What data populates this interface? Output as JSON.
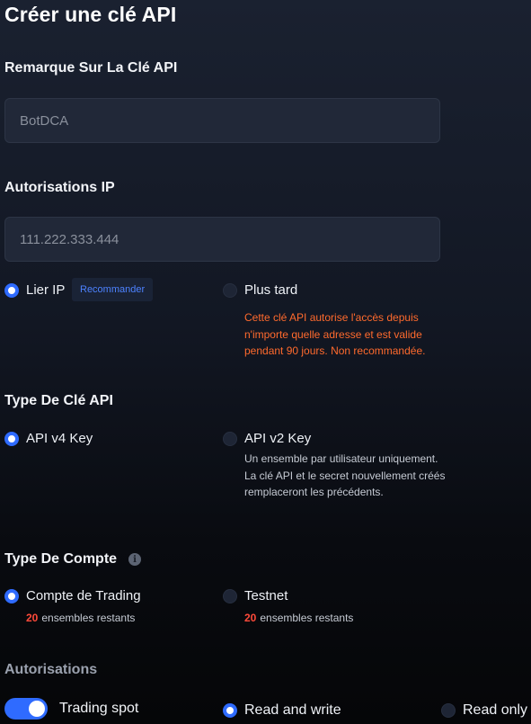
{
  "page": {
    "title": "Créer une clé API"
  },
  "api_note": {
    "label": "Remarque Sur La Clé API",
    "value": "BotDCA"
  },
  "ip_permissions": {
    "label": "Autorisations IP",
    "value": "111.222.333.444",
    "options": [
      {
        "label": "Lier IP",
        "selected": true,
        "badge": "Recommander"
      },
      {
        "label": "Plus tard",
        "selected": false
      }
    ],
    "warning": "Cette clé API autorise l'accès depuis n'importe quelle adresse et est valide pendant 90 jours. Non recommandée."
  },
  "key_type": {
    "label": "Type De Clé API",
    "options": [
      {
        "label": "API v4 Key",
        "selected": true
      },
      {
        "label": "API v2 Key",
        "selected": false
      }
    ],
    "v2_description": "Un ensemble par utilisateur uniquement. La clé API et le secret nouvellement créés remplaceront les précédents."
  },
  "account_type": {
    "label": "Type De Compte",
    "info_icon": "info-icon",
    "options": [
      {
        "label": "Compte de Trading",
        "selected": true,
        "remaining_count": "20",
        "remaining_text": "ensembles restants"
      },
      {
        "label": "Testnet",
        "selected": false,
        "remaining_count": "20",
        "remaining_text": "ensembles restants"
      }
    ]
  },
  "permissions": {
    "label": "Autorisations",
    "spot": {
      "label": "Trading spot",
      "enabled": true,
      "options": [
        {
          "label": "Read and write",
          "selected": true
        },
        {
          "label": "Read only",
          "selected": false
        }
      ]
    }
  },
  "colors": {
    "accent": "#2f6bff",
    "warning": "#ff6a2d",
    "count_highlight": "#ff4a3a"
  }
}
